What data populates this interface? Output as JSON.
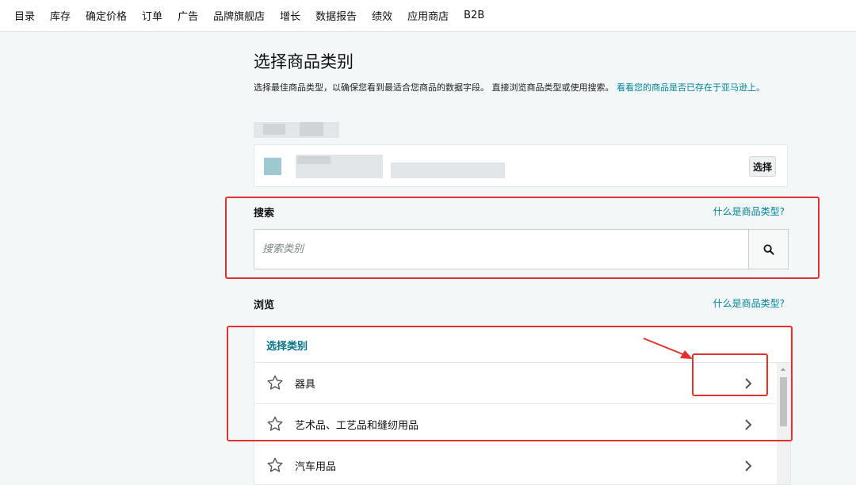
{
  "nav": {
    "items": [
      "目录",
      "库存",
      "确定价格",
      "订单",
      "广告",
      "品牌旗舰店",
      "增长",
      "数据报告",
      "绩效",
      "应用商店",
      "B2B"
    ]
  },
  "page": {
    "title": "选择商品类别",
    "description": "选择最佳商品类型，以确保您看到最适合您商品的数据字段。 直接浏览商品类型或使用搜索。",
    "description_link": "看看您的商品是否已存在于亚马逊上。"
  },
  "product": {
    "select_button": "选择"
  },
  "search": {
    "label": "搜索",
    "help_link": "什么是商品类型?",
    "placeholder": "搜索类别",
    "value": ""
  },
  "browse": {
    "label": "浏览",
    "help_link": "什么是商品类型?",
    "panel_header": "选择类别",
    "categories": [
      {
        "label": "器具"
      },
      {
        "label": "艺术品、工艺品和缝纫用品"
      },
      {
        "label": "汽车用品"
      }
    ]
  },
  "colors": {
    "accent_link": "#008296",
    "annotation_red": "#e0322d"
  }
}
